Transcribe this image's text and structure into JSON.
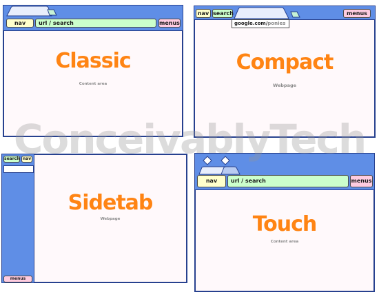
{
  "watermark": "ConceivablyTech",
  "classic": {
    "title": "Classic",
    "nav_label": "nav",
    "url_label": "url / search",
    "menus_label": "menus",
    "content_label": "Content area"
  },
  "compact": {
    "title": "Compact",
    "nav_label": "nav",
    "search_label": "search",
    "menus_label": "menus",
    "url_host": "google.com/",
    "url_path": "ponies",
    "content_label": "Webpage"
  },
  "sidetab": {
    "title": "Sidetab",
    "search_label": "search",
    "nav_label": "nav",
    "menus_label": "menus",
    "content_label": "Webpage"
  },
  "touch": {
    "title": "Touch",
    "nav_label": "nav",
    "url_label": "url / search",
    "menus_label": "menus",
    "content_label": "Content area"
  }
}
